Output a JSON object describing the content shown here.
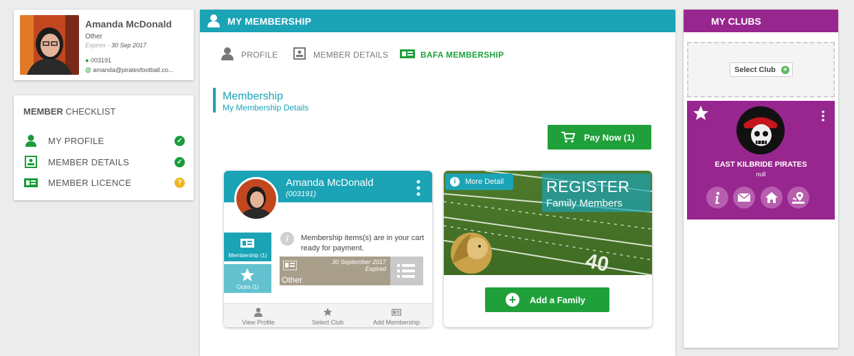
{
  "profile": {
    "name": "Amanda McDonald",
    "role": "Other",
    "expires_label": "Expires - ",
    "expires_date": "30 Sep 2017",
    "member_id": "003191",
    "email": "amanda@piratesfootball.co..."
  },
  "checklist": {
    "title_bold": "MEMBER",
    "title_rest": " CHECKLIST",
    "items": [
      {
        "label": "MY PROFILE",
        "status": "complete",
        "status_color": "#1a9b3c"
      },
      {
        "label": "MEMBER DETAILS",
        "status": "complete",
        "status_color": "#1a9b3c"
      },
      {
        "label": "MEMBER LICENCE",
        "status": "pending",
        "status_color": "#f0b323"
      }
    ]
  },
  "main": {
    "title": "MY MEMBERSHIP",
    "tabs": [
      {
        "label": "PROFILE",
        "active": false
      },
      {
        "label": "MEMBER DETAILS",
        "active": false
      },
      {
        "label": "BAFA MEMBERSHIP",
        "active": true
      }
    ],
    "section_title": "Membership",
    "section_subtitle": "My Membership Details",
    "pay_button": "Pay Now (1)"
  },
  "member_card": {
    "name": "Amanda McDonald",
    "id": "(003191)",
    "side_tabs": [
      "Membership (1)",
      "Clubs (1)"
    ],
    "info_text": "Membership items(s) are in your cart ready for payment.",
    "membership_date": "30 September 2017",
    "membership_status": "Expired",
    "membership_type": "Other",
    "footer": [
      "View Profile",
      "Select Club",
      "Add Membership"
    ]
  },
  "register_card": {
    "more_detail": "More Detail",
    "title": "REGISTER",
    "subtitle": "Family Members",
    "field_marking": "40",
    "button": "Add a Family"
  },
  "clubs": {
    "title": "MY CLUBS",
    "select_button": "Select Club",
    "club_name": "EAST KILBRIDE PIRATES",
    "club_sub": "null"
  },
  "colors": {
    "teal": "#1ba3b6",
    "green": "#1fa03b",
    "purple": "#97268e"
  }
}
